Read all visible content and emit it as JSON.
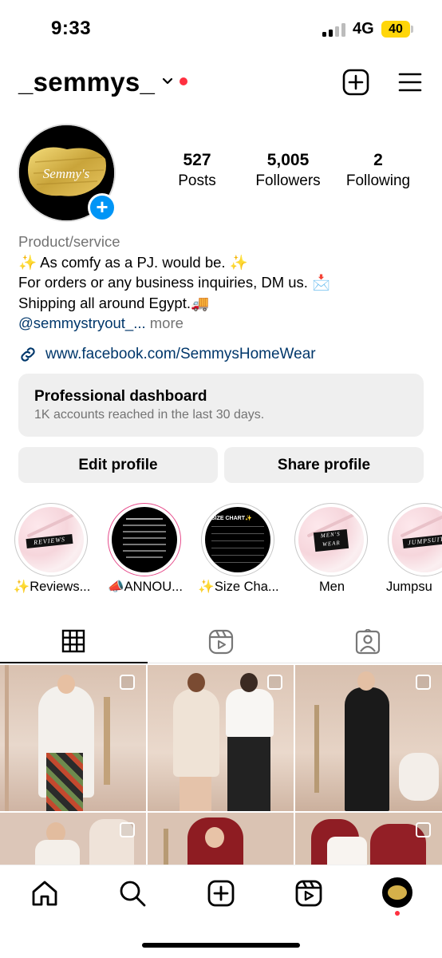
{
  "status_bar": {
    "time": "9:33",
    "network": "4G",
    "battery": "40"
  },
  "header": {
    "username": "_semmys_"
  },
  "profile": {
    "stats": [
      {
        "value": "527",
        "label": "Posts"
      },
      {
        "value": "5,005",
        "label": "Followers"
      },
      {
        "value": "2",
        "label": "Following"
      }
    ],
    "category": "Product/service",
    "bio_lines": [
      "✨ As comfy as a PJ. would be. ✨",
      "For orders or any business inquiries, DM us. 📩",
      "Shipping all around Egypt.🚚"
    ],
    "mention": "@semmystryout_...",
    "more": "more",
    "link": "www.facebook.com/SemmysHomeWear",
    "avatar_text": "Semmy's"
  },
  "dashboard": {
    "title": "Professional dashboard",
    "subtitle": "1K accounts reached in the last 30 days."
  },
  "buttons": {
    "edit": "Edit profile",
    "share": "Share profile"
  },
  "highlights": [
    {
      "label": "✨Reviews...",
      "tag": "REVIEWS"
    },
    {
      "label": "📣ANNOU..."
    },
    {
      "label": "✨Size Cha...",
      "tag": "SIZE CHART✨"
    },
    {
      "label": "Men",
      "tag": "MEN'S WEAR"
    },
    {
      "label": "Jumpsu",
      "tag": "JUMPSUIT"
    }
  ],
  "tabs": [
    "posts-grid",
    "reels",
    "tagged"
  ],
  "colors": {
    "accent_blue": "#0095f6",
    "link_blue": "#00376b",
    "notification_red": "#ff3040",
    "battery_yellow": "#ffd60a"
  }
}
